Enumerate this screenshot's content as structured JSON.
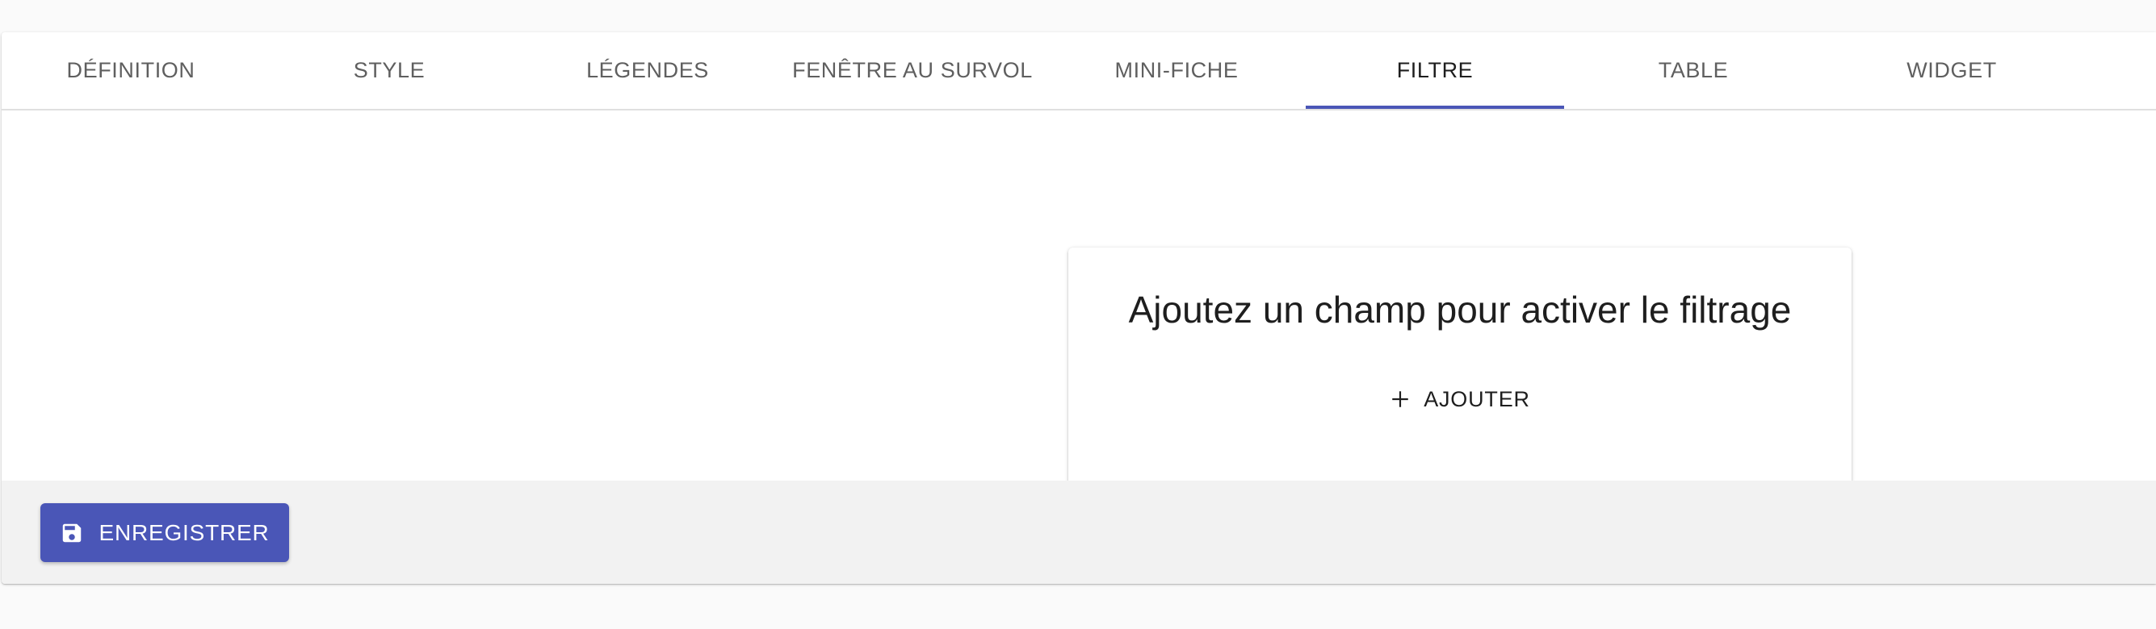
{
  "tabs": [
    {
      "label": "DÉFINITION",
      "active": false
    },
    {
      "label": "STYLE",
      "active": false
    },
    {
      "label": "LÉGENDES",
      "active": false
    },
    {
      "label": "FENÊTRE AU SURVOL",
      "active": false
    },
    {
      "label": "MINI-FICHE",
      "active": false
    },
    {
      "label": "FILTRE",
      "active": true
    },
    {
      "label": "TABLE",
      "active": false
    },
    {
      "label": "WIDGET",
      "active": false
    }
  ],
  "filter_card": {
    "title": "Ajoutez un champ pour activer le filtrage",
    "add_label": "AJOUTER",
    "add_icon": "plus-icon"
  },
  "footer": {
    "save_label": "ENREGISTRER",
    "save_icon": "floppy-disk-icon"
  },
  "colors": {
    "accent": "#4a56b7",
    "tab_text": "#5f5f5f",
    "tab_text_active": "#1e1e1e",
    "footer_bg": "#f2f2f2"
  }
}
